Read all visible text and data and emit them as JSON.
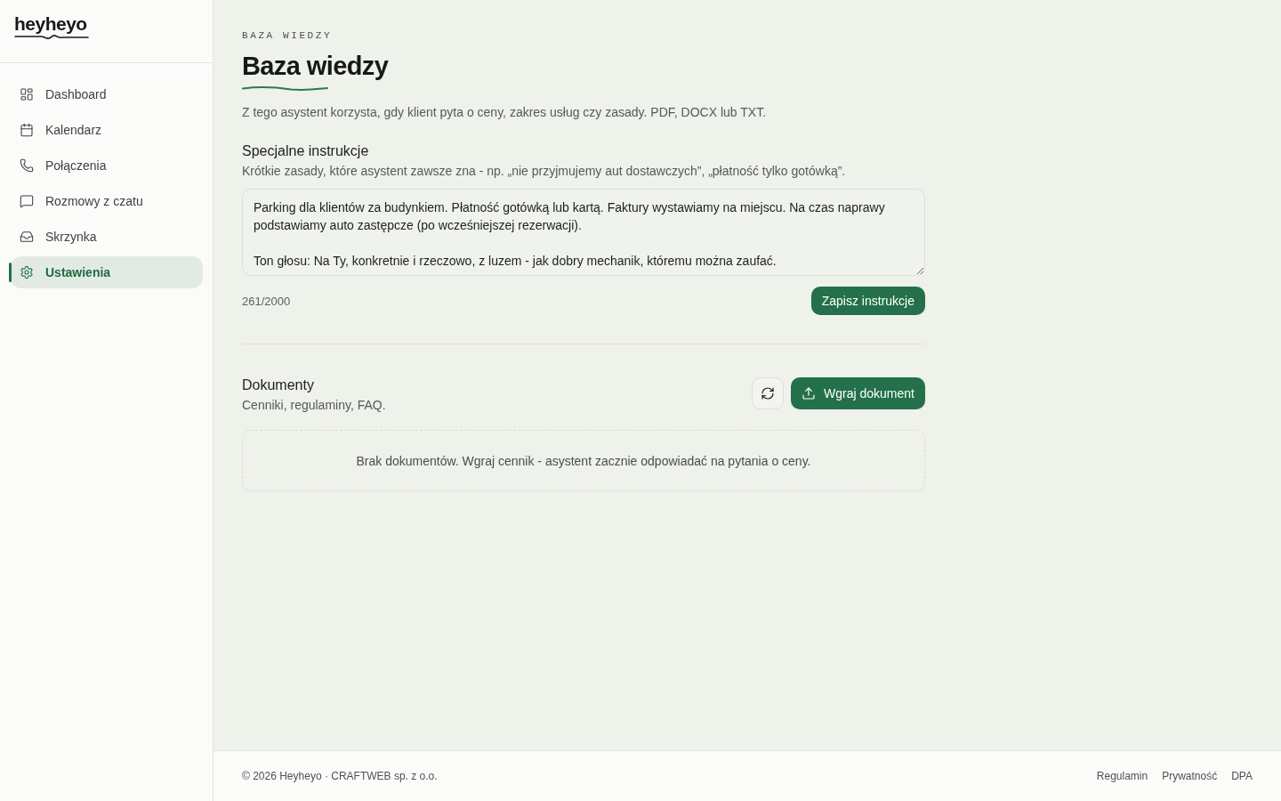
{
  "sidebar": {
    "logo": "heyheyo",
    "items": [
      {
        "label": "Dashboard",
        "selected": false
      },
      {
        "label": "Kalendarz",
        "selected": false
      },
      {
        "label": "Połączenia",
        "selected": false
      },
      {
        "label": "Rozmowy z czatu",
        "selected": false
      },
      {
        "label": "Skrzynka",
        "selected": false
      },
      {
        "label": "Ustawienia",
        "selected": true
      }
    ]
  },
  "header": {
    "eyebrow": "BAZA WIEDZY",
    "title": "Baza wiedzy",
    "description": "Z tego asystent korzysta, gdy klient pyta o ceny, zakres usług czy zasady. PDF, DOCX lub TXT."
  },
  "instructions": {
    "title": "Specjalne instrukcje",
    "hint": "Krótkie zasady, które asystent zawsze zna - np. „nie przyjmujemy aut dostawczych”, „płatność tylko gotówką”.",
    "value": "Parking dla klientów za budynkiem. Płatność gotówką lub kartą. Faktury wystawiamy na miejscu. Na czas naprawy podstawiamy auto zastępcze (po wcześniejszej rezerwacji).\n\nTon głosu: Na Ty, konkretnie i rzeczowo, z luzem - jak dobry mechanik, któremu można zaufać.",
    "counter": "261/2000",
    "save_button": "Zapisz instrukcje"
  },
  "documents": {
    "title": "Dokumenty",
    "subtitle": "Cenniki, regulaminy, FAQ.",
    "upload_button": "Wgraj dokument",
    "empty_message": "Brak dokumentów. Wgraj cennik - asystent zacznie odpowiadać na pytania o ceny."
  },
  "footer": {
    "copyright": "© 2026 Heyheyo · CRAFTWEB sp. z o.o.",
    "links": [
      "Regulamin",
      "Prywatność",
      "DPA"
    ]
  }
}
